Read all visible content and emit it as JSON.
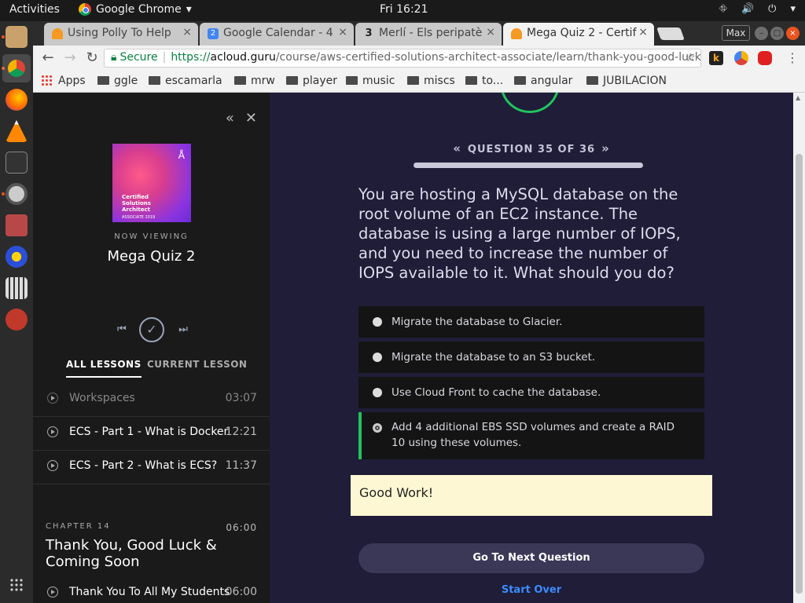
{
  "system": {
    "activities": "Activities",
    "app_name": "Google Chrome",
    "app_menu_caret": "▾",
    "clock": "Fri 16:21",
    "tray_icons": [
      "network-icon",
      "volume-icon",
      "power-icon",
      "system-menu-icon"
    ]
  },
  "dock": {
    "items": [
      "files-icon",
      "chrome-icon",
      "firefox-icon",
      "vlc-icon",
      "terminal-icon",
      "software-updater-icon",
      "app-icon",
      "helper-icon",
      "video-editor-icon",
      "settings-tools-icon"
    ]
  },
  "browser": {
    "tabs": [
      {
        "title": "Using Polly To Help",
        "icon": "acloud-guru-icon",
        "icon_color": "#f59a23",
        "active": false
      },
      {
        "title": "Google Calendar - 4",
        "icon": "calendar-icon",
        "icon_glyph": "2",
        "icon_color": "#4285f4",
        "active": false
      },
      {
        "title": "Merlí - Els peripatè",
        "icon": "tv3-icon",
        "icon_glyph": "3",
        "icon_color": "#444444",
        "active": false
      },
      {
        "title": "Mega Quiz 2 - Certif",
        "icon": "acloud-guru-icon",
        "icon_color": "#f59a23",
        "active": true
      }
    ],
    "tab_close": "×",
    "max_label": "Max",
    "secure_label": "Secure",
    "url_scheme": "https://",
    "url_host": "acloud.guru",
    "url_path": "/course/aws-certified-solutions-architect-associate/learn/thank-you-good-luck-c...",
    "bookmarks": [
      "Apps",
      "ggle",
      "escamarla",
      "mrw",
      "player",
      "music",
      "miscs",
      "to...",
      "angular",
      "JUBILACION"
    ]
  },
  "sidebar": {
    "course_image_text": "Certified Solutions Architect",
    "course_image_sub": "ASSOCIATE 2019",
    "now_viewing_label": "NOW VIEWING",
    "course_title": "Mega Quiz 2",
    "tabs": [
      "ALL LESSONS",
      "CURRENT LESSON"
    ],
    "lessons": [
      {
        "title": "Workspaces",
        "duration": "03:07"
      },
      {
        "title": "ECS - Part 1 - What is Docker",
        "duration": "12:21"
      },
      {
        "title": "ECS - Part 2 - What is ECS?",
        "duration": "11:37"
      }
    ],
    "chapter": {
      "label": "CHAPTER 14",
      "duration": "06:00",
      "title": "Thank You, Good Luck & Coming Soon",
      "lessons": [
        {
          "title": "Thank You To All My Students",
          "duration": "06:00"
        }
      ]
    }
  },
  "quiz": {
    "nav_label": "QUESTION 35 OF 36",
    "progress_fraction": 0.97,
    "question": "You are hosting a MySQL database on the root volume of an EC2 instance. The database is using a large number of IOPS, and you need to increase the number of IOPS available to it. What should you do?",
    "options": [
      {
        "text": "Migrate the database to Glacier.",
        "selected": false,
        "correct": false
      },
      {
        "text": "Migrate the database to an S3 bucket.",
        "selected": false,
        "correct": false
      },
      {
        "text": "Use Cloud Front to cache the database.",
        "selected": false,
        "correct": false
      },
      {
        "text": "Add 4 additional EBS SSD volumes and create a RAID 10 using these volumes.",
        "selected": true,
        "correct": true
      }
    ],
    "feedback": "Good Work!",
    "next_label": "Go To Next Question",
    "start_over_label": "Start Over"
  },
  "colors": {
    "page_bg": "#1f1d38",
    "sidebar_bg": "#1a1a1a",
    "correct_green": "#22c35e",
    "feedback_bg": "#fdf8d3",
    "link_blue": "#3d8bff",
    "secure_green": "#0b8043"
  }
}
